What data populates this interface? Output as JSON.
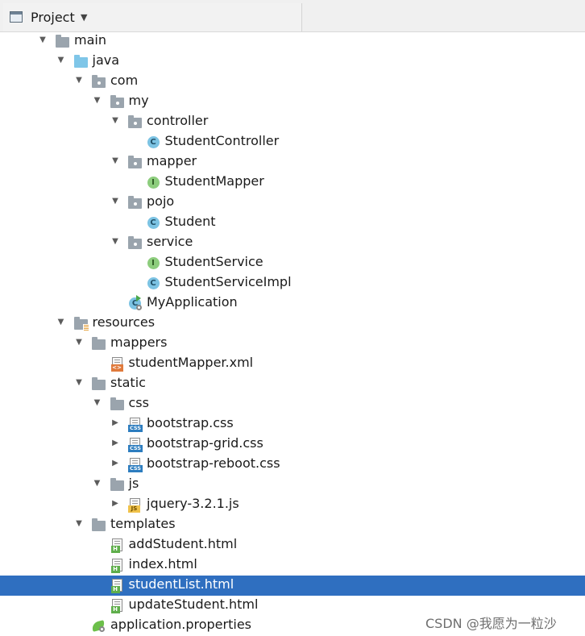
{
  "header": {
    "title": "Project",
    "arrow": "▼"
  },
  "tree": [
    {
      "label": "main",
      "depth": 0,
      "toggle": "▼",
      "icon": "folder-icon",
      "kind": "folder"
    },
    {
      "label": "java",
      "depth": 1,
      "toggle": "▼",
      "icon": "source-folder-icon",
      "kind": "folder-blue"
    },
    {
      "label": "com",
      "depth": 2,
      "toggle": "▼",
      "icon": "package-icon",
      "kind": "package"
    },
    {
      "label": "my",
      "depth": 3,
      "toggle": "▼",
      "icon": "package-icon",
      "kind": "package"
    },
    {
      "label": "controller",
      "depth": 4,
      "toggle": "▼",
      "icon": "package-icon",
      "kind": "package"
    },
    {
      "label": "StudentController",
      "depth": 5,
      "toggle": "",
      "icon": "class-icon",
      "kind": "class"
    },
    {
      "label": "mapper",
      "depth": 4,
      "toggle": "▼",
      "icon": "package-icon",
      "kind": "package"
    },
    {
      "label": "StudentMapper",
      "depth": 5,
      "toggle": "",
      "icon": "interface-icon",
      "kind": "interface"
    },
    {
      "label": "pojo",
      "depth": 4,
      "toggle": "▼",
      "icon": "package-icon",
      "kind": "package"
    },
    {
      "label": "Student",
      "depth": 5,
      "toggle": "",
      "icon": "class-icon",
      "kind": "class"
    },
    {
      "label": "service",
      "depth": 4,
      "toggle": "▼",
      "icon": "package-icon",
      "kind": "package"
    },
    {
      "label": "StudentService",
      "depth": 5,
      "toggle": "",
      "icon": "interface-icon",
      "kind": "interface"
    },
    {
      "label": "StudentServiceImpl",
      "depth": 5,
      "toggle": "",
      "icon": "class-icon",
      "kind": "class"
    },
    {
      "label": "MyApplication",
      "depth": 4,
      "toggle": "",
      "icon": "spring-boot-class-icon",
      "kind": "app"
    },
    {
      "label": "resources",
      "depth": 1,
      "toggle": "▼",
      "icon": "resources-folder-icon",
      "kind": "resources"
    },
    {
      "label": "mappers",
      "depth": 2,
      "toggle": "▼",
      "icon": "folder-icon",
      "kind": "folder"
    },
    {
      "label": "studentMapper.xml",
      "depth": 3,
      "toggle": "",
      "icon": "xml-file-icon",
      "kind": "xml"
    },
    {
      "label": "static",
      "depth": 2,
      "toggle": "▼",
      "icon": "folder-icon",
      "kind": "folder"
    },
    {
      "label": "css",
      "depth": 3,
      "toggle": "▼",
      "icon": "folder-icon",
      "kind": "folder"
    },
    {
      "label": "bootstrap.css",
      "depth": 4,
      "toggle": "▶",
      "icon": "css-file-icon",
      "kind": "css"
    },
    {
      "label": "bootstrap-grid.css",
      "depth": 4,
      "toggle": "▶",
      "icon": "css-file-icon",
      "kind": "css"
    },
    {
      "label": "bootstrap-reboot.css",
      "depth": 4,
      "toggle": "▶",
      "icon": "css-file-icon",
      "kind": "css"
    },
    {
      "label": "js",
      "depth": 3,
      "toggle": "▼",
      "icon": "folder-icon",
      "kind": "folder"
    },
    {
      "label": "jquery-3.2.1.js",
      "depth": 4,
      "toggle": "▶",
      "icon": "js-file-icon",
      "kind": "js"
    },
    {
      "label": "templates",
      "depth": 2,
      "toggle": "▼",
      "icon": "folder-icon",
      "kind": "folder"
    },
    {
      "label": "addStudent.html",
      "depth": 3,
      "toggle": "",
      "icon": "html-file-icon",
      "kind": "html"
    },
    {
      "label": "index.html",
      "depth": 3,
      "toggle": "",
      "icon": "html-file-icon",
      "kind": "html"
    },
    {
      "label": "studentList.html",
      "depth": 3,
      "toggle": "",
      "icon": "html-file-icon",
      "kind": "html",
      "selected": true
    },
    {
      "label": "updateStudent.html",
      "depth": 3,
      "toggle": "",
      "icon": "html-file-icon",
      "kind": "html"
    },
    {
      "label": "application.properties",
      "depth": 2,
      "toggle": "",
      "icon": "spring-properties-icon",
      "kind": "properties"
    }
  ],
  "watermark": "CSDN @我愿为一粒沙",
  "colors": {
    "selection": "#2f6fc0",
    "header_bg": "#f0f0f0"
  }
}
